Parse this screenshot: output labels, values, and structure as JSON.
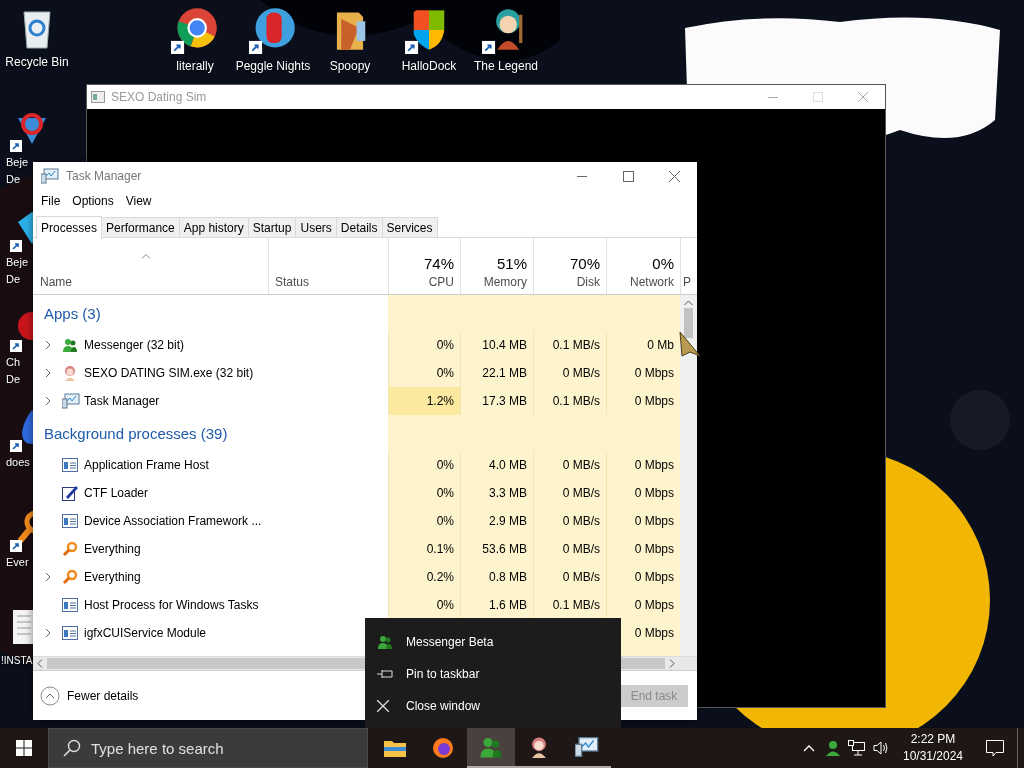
{
  "desktop_icons": [
    {
      "lines": [
        "Recycle Bin"
      ]
    },
    {
      "lines": [
        "literally"
      ]
    },
    {
      "lines": [
        "Peggle Nights"
      ]
    },
    {
      "lines": [
        "Spoopy"
      ]
    },
    {
      "lines": [
        "HalloDock"
      ]
    },
    {
      "lines": [
        "The Legend"
      ]
    },
    {
      "lines": [
        "Beje",
        "De"
      ]
    },
    {
      "lines": [
        "Beje",
        "De"
      ]
    },
    {
      "lines": [
        "Ch",
        "De"
      ]
    },
    {
      "lines": [
        "does"
      ]
    },
    {
      "lines": [
        "Ever"
      ]
    },
    {
      "lines": [
        "!INSTA"
      ]
    }
  ],
  "background_window": {
    "title": "SEXO Dating Sim"
  },
  "task_manager": {
    "title": "Task Manager",
    "menu": [
      "File",
      "Options",
      "View"
    ],
    "tabs": [
      {
        "label": "Processes",
        "selected": true
      },
      {
        "label": "Performance",
        "selected": false
      },
      {
        "label": "App history",
        "selected": false
      },
      {
        "label": "Startup",
        "selected": false
      },
      {
        "label": "Users",
        "selected": false
      },
      {
        "label": "Details",
        "selected": false
      },
      {
        "label": "Services",
        "selected": false
      }
    ],
    "columns": [
      {
        "label": "Name"
      },
      {
        "label": "Status"
      },
      {
        "percent": "74%",
        "label": "CPU"
      },
      {
        "percent": "51%",
        "label": "Memory"
      },
      {
        "percent": "70%",
        "label": "Disk"
      },
      {
        "percent": "0%",
        "label": "Network"
      },
      {
        "label": "P"
      }
    ],
    "groups": [
      {
        "title": "Apps (3)",
        "rows": [
          {
            "name": "Messenger (32 bit)",
            "expandable": true,
            "cpu": "0%",
            "memory": "10.4 MB",
            "disk": "0.1 MB/s",
            "network": "0 Mb"
          },
          {
            "name": "SEXO DATING SIM.exe (32 bit)",
            "expandable": true,
            "cpu": "0%",
            "memory": "22.1 MB",
            "disk": "0 MB/s",
            "network": "0 Mbps"
          },
          {
            "name": "Task Manager",
            "expandable": true,
            "cpu": "1.2%",
            "memory": "17.3 MB",
            "disk": "0.1 MB/s",
            "network": "0 Mbps"
          }
        ]
      },
      {
        "title": "Background processes (39)",
        "rows": [
          {
            "name": "Application Frame Host",
            "expandable": false,
            "cpu": "0%",
            "memory": "4.0 MB",
            "disk": "0 MB/s",
            "network": "0 Mbps"
          },
          {
            "name": "CTF Loader",
            "expandable": false,
            "cpu": "0%",
            "memory": "3.3 MB",
            "disk": "0 MB/s",
            "network": "0 Mbps"
          },
          {
            "name": "Device Association Framework ...",
            "expandable": false,
            "cpu": "0%",
            "memory": "2.9 MB",
            "disk": "0 MB/s",
            "network": "0 Mbps"
          },
          {
            "name": "Everything",
            "expandable": false,
            "cpu": "0.1%",
            "memory": "53.6 MB",
            "disk": "0 MB/s",
            "network": "0 Mbps"
          },
          {
            "name": "Everything",
            "expandable": true,
            "cpu": "0.2%",
            "memory": "0.8 MB",
            "disk": "0 MB/s",
            "network": "0 Mbps"
          },
          {
            "name": "Host Process for Windows Tasks",
            "expandable": false,
            "cpu": "0%",
            "memory": "1.6 MB",
            "disk": "0.1 MB/s",
            "network": "0 Mbps"
          },
          {
            "name": "igfxCUIService Module",
            "expandable": true,
            "network": "0 Mbps"
          }
        ]
      }
    ],
    "fewer_details": "Fewer details",
    "end_task": {
      "label": "End task",
      "disabled": true
    }
  },
  "jump_menu": {
    "items": [
      "Messenger Beta",
      "Pin to taskbar",
      "Close window"
    ]
  },
  "taskbar": {
    "search": {
      "placeholder": "Type here to search"
    },
    "apps": [
      {
        "running": false,
        "selected": false
      },
      {
        "running": false,
        "selected": false
      },
      {
        "running": true,
        "selected": true
      },
      {
        "running": true,
        "selected": false
      },
      {
        "running": true,
        "selected": false
      }
    ],
    "clock": {
      "time": "2:22 PM",
      "date": "10/31/2024"
    }
  }
}
